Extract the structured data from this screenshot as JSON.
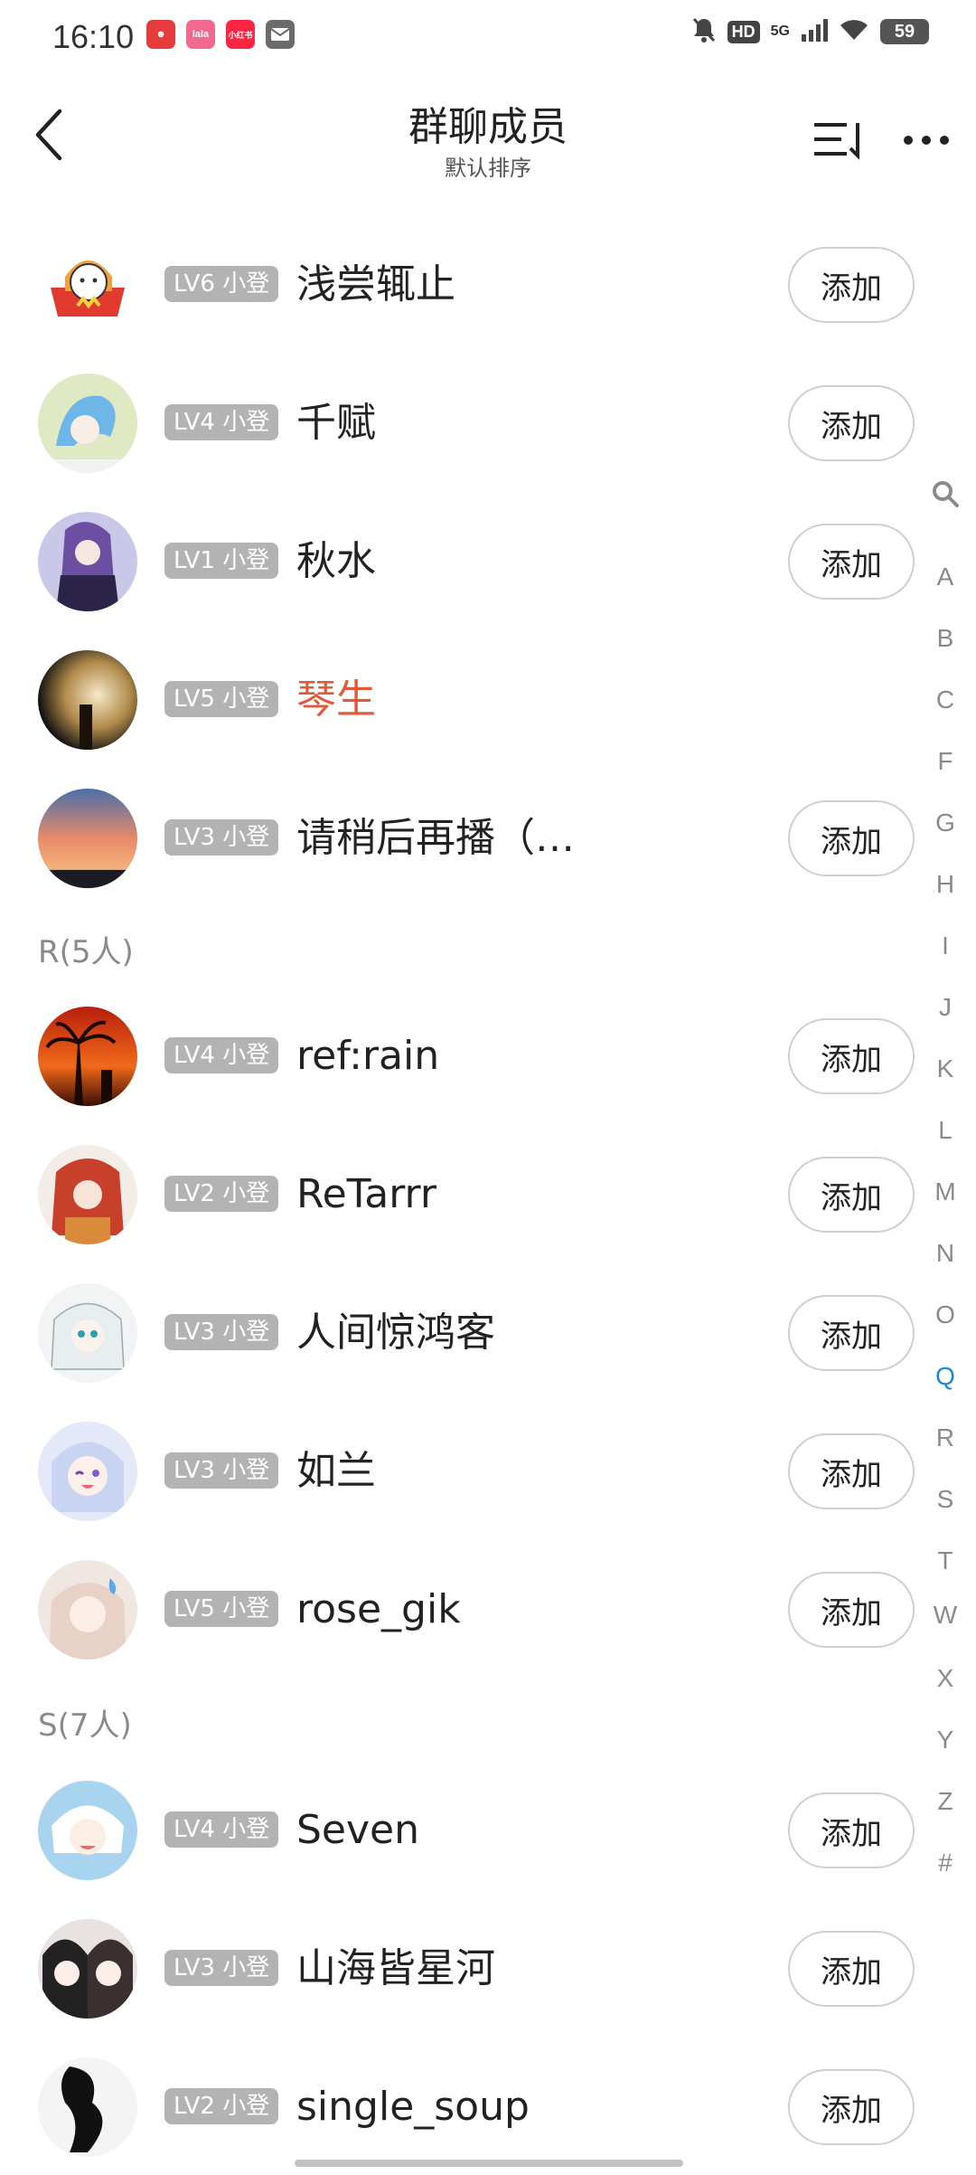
{
  "status_bar": {
    "time": "16:10",
    "apps": [
      {
        "icon": "clown-app-icon",
        "color": "#e63b3b",
        "label": ""
      },
      {
        "icon": "lalafan-app-icon",
        "color": "#f2688f",
        "label": "lala"
      },
      {
        "icon": "xiaohongshu-app-icon",
        "color": "#ff2442",
        "label": "小红书"
      },
      {
        "icon": "mail-icon",
        "color": "#6b6b6b",
        "label": ""
      }
    ],
    "hd": "HD",
    "network": "5G",
    "battery": "59"
  },
  "header": {
    "title": "群聊成员",
    "subtitle": "默认排序"
  },
  "add_label": "添加",
  "sections": [
    {
      "header": "R(5人)"
    },
    {
      "header": "S(7人)"
    }
  ],
  "members": [
    {
      "level": "LV6 小登",
      "name": "浅尝辄止",
      "has_add": true,
      "avatar": "cat-box"
    },
    {
      "level": "LV4 小登",
      "name": "千赋",
      "has_add": true,
      "avatar": "blue-hair"
    },
    {
      "level": "LV1 小登",
      "name": "秋水",
      "has_add": true,
      "avatar": "purple-girl"
    },
    {
      "level": "LV5 小登",
      "name": "琴生",
      "has_add": false,
      "avatar": "dark-glow",
      "highlight": true
    },
    {
      "level": "LV3 小登",
      "name": "请稍后再播（…",
      "has_add": true,
      "avatar": "sunset"
    },
    {
      "level": "LV4 小登",
      "name": "ref:rain",
      "has_add": true,
      "avatar": "palm-sunset"
    },
    {
      "level": "LV2 小登",
      "name": "ReTarrr",
      "has_add": true,
      "avatar": "red-hair"
    },
    {
      "level": "LV3 小登",
      "name": "人间惊鸿客",
      "has_add": true,
      "avatar": "white-hair"
    },
    {
      "level": "LV3 小登",
      "name": "如兰",
      "has_add": true,
      "avatar": "wink-girl"
    },
    {
      "level": "LV5 小登",
      "name": "rose_gik",
      "has_add": true,
      "avatar": "sweat-girl"
    },
    {
      "level": "LV4 小登",
      "name": "Seven",
      "has_add": true,
      "avatar": "white-child"
    },
    {
      "level": "LV3 小登",
      "name": "山海皆星河",
      "has_add": true,
      "avatar": "couple"
    },
    {
      "level": "LV2 小登",
      "name": "single_soup",
      "has_add": true,
      "avatar": "ink"
    }
  ],
  "index_bar": {
    "search_icon": "search-icon",
    "letters": [
      "A",
      "B",
      "C",
      "F",
      "G",
      "H",
      "I",
      "J",
      "K",
      "L",
      "M",
      "N",
      "O",
      "Q",
      "R",
      "S",
      "T",
      "W",
      "X",
      "Y",
      "Z",
      "#"
    ],
    "active": "Q",
    "active_color": "#1a8ad4"
  },
  "colors": {
    "level_badge": "#b3b3b3",
    "highlight_name": "#e05a3a",
    "section_header": "#8a8a8a"
  }
}
